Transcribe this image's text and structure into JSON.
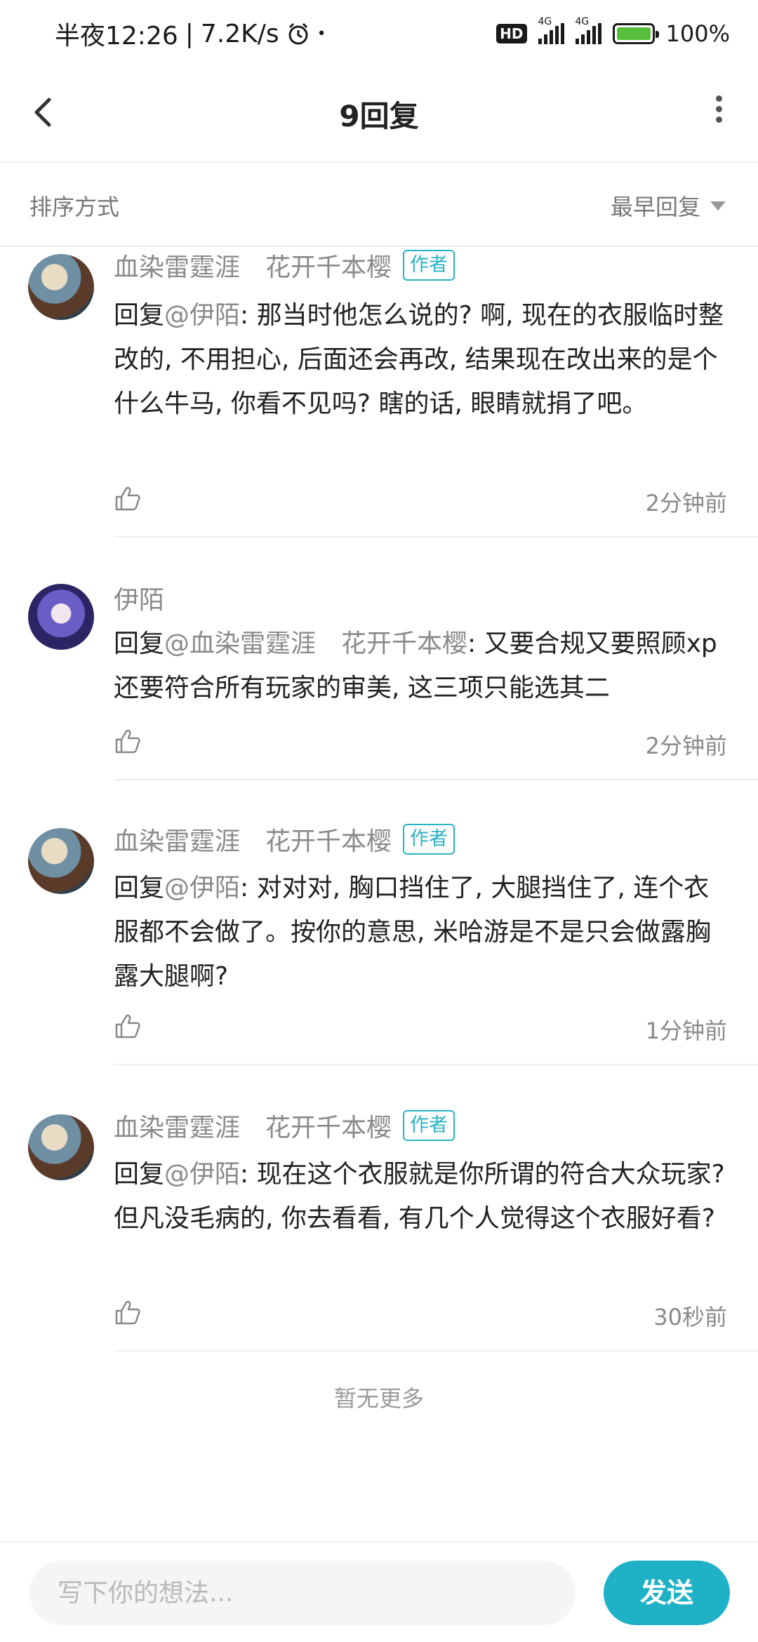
{
  "status_bar": {
    "time": "半夜12:26",
    "separator": "|",
    "network_speed": "7.2K/s",
    "alarm_icon": "alarm-clock-icon",
    "dot": "•",
    "hd": "HD",
    "signal1_tag": "4G",
    "signal2_tag": "4G",
    "battery": "100%",
    "battery_level": 1.0,
    "battery_color": "#56c03a"
  },
  "header": {
    "title": "9回复",
    "back_icon": "chevron-left-icon",
    "more_icon": "more-vertical-icon"
  },
  "sort": {
    "label": "排序方式",
    "value": "最早回复",
    "icon": "dropdown-triangle-icon"
  },
  "comments": [
    {
      "author": "血染雷霆涯　花开千本樱",
      "badge": "作者",
      "reply_prefix": "回复",
      "mention": "@伊陌",
      "text": ": 那当时他怎么说的? 啊, 现在的衣服临时整改的, 不用担心, 后面还会再改, 结果现在改出来的是个什么牛马, 你看不见吗? 瞎的话, 眼睛就捐了吧。",
      "time": "2分钟前"
    },
    {
      "author": "伊陌",
      "badge": "",
      "reply_prefix": "回复",
      "mention": "@血染雷霆涯　花开千本樱",
      "text": ": 又要合规又要照顾xp还要符合所有玩家的审美, 这三项只能选其二",
      "time": "2分钟前"
    },
    {
      "author": "血染雷霆涯　花开千本樱",
      "badge": "作者",
      "reply_prefix": "回复",
      "mention": "@伊陌",
      "text": ": 对对对, 胸口挡住了, 大腿挡住了, 连个衣服都不会做了。按你的意思, 米哈游是不是只会做露胸露大腿啊?",
      "time": "1分钟前"
    },
    {
      "author": "血染雷霆涯　花开千本樱",
      "badge": "作者",
      "reply_prefix": "回复",
      "mention": "@伊陌",
      "text": ": 现在这个衣服就是你所谓的符合大众玩家? 但凡没毛病的, 你去看看, 有几个人觉得这个衣服好看?",
      "time": "30秒前"
    }
  ],
  "footer": {
    "no_more": "暂无更多",
    "input_placeholder": "写下你的想法...",
    "send_label": "发送",
    "accent_color": "#1fb2c7"
  }
}
